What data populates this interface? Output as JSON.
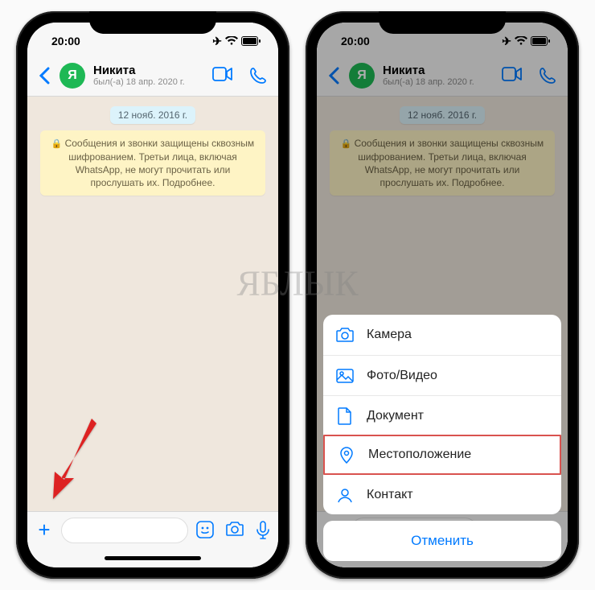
{
  "status": {
    "time": "20:00"
  },
  "header": {
    "avatar_letter": "Я",
    "contact_name": "Никита",
    "contact_status": "был(-а) 18 апр. 2020 г."
  },
  "chat": {
    "date": "12 нояб. 2016 г.",
    "encryption_notice": "Сообщения и звонки защищены сквозным шифрованием. Третьи лица, включая WhatsApp, не могут прочитать или прослушать их. Подробнее."
  },
  "action_sheet": {
    "items": [
      {
        "icon": "camera",
        "label": "Камера"
      },
      {
        "icon": "photo",
        "label": "Фото/Видео"
      },
      {
        "icon": "document",
        "label": "Документ"
      },
      {
        "icon": "location",
        "label": "Местоположение",
        "highlight": true
      },
      {
        "icon": "contact",
        "label": "Контакт"
      }
    ],
    "cancel": "Отменить"
  },
  "watermark": "ЯБЛЫК"
}
